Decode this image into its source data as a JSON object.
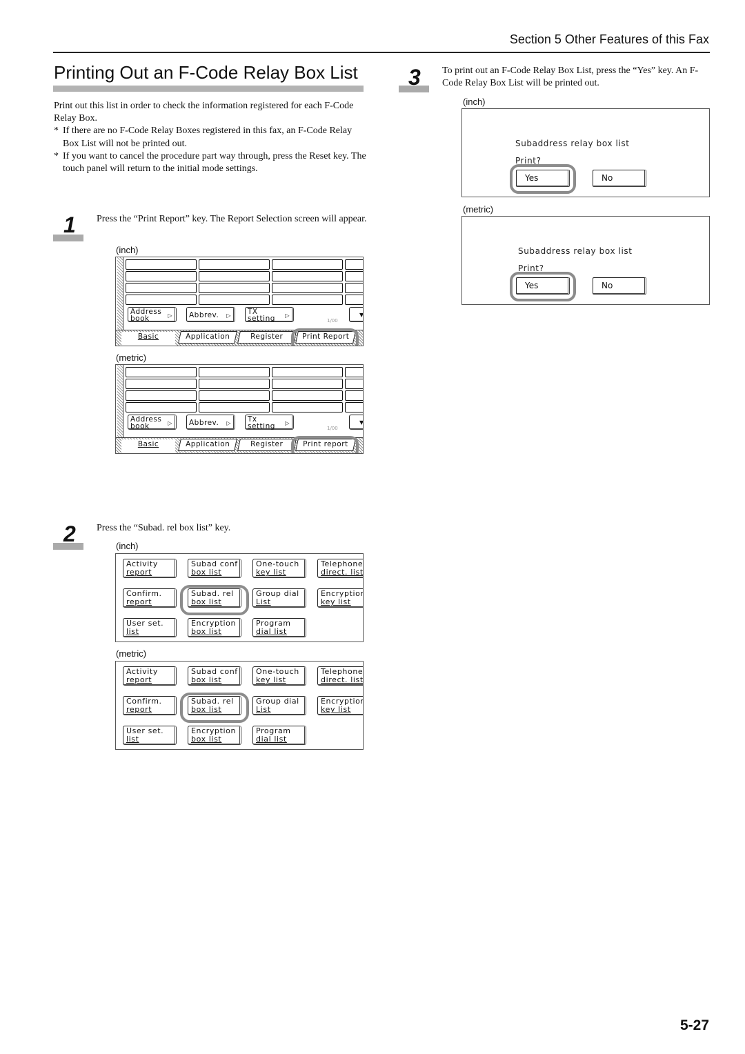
{
  "header": {
    "section": "Section 5  Other Features of this Fax"
  },
  "title": "Printing Out an F-Code Relay Box List",
  "intro": {
    "paragraph": "Print out this list in order to check the information registered for each F-Code Relay Box.",
    "notes": [
      "If there are no F-Code Relay Boxes registered in this fax, an F-Code Relay Box List will not be printed out.",
      "If you want to cancel the procedure part way through, press the Reset key. The touch panel will return to the initial mode settings."
    ],
    "bullet_marker": "*"
  },
  "steps": [
    {
      "number": "1",
      "text": "Press the “Print Report” key. The Report Selection screen will appear.",
      "screens": [
        {
          "caption": "(inch)",
          "keys": [
            {
              "line1": "Address",
              "line2": "book",
              "arrow": "▷"
            },
            {
              "line1": "Abbrev.",
              "line2": "",
              "arrow": "▷"
            },
            {
              "line1": "TX",
              "line2": "setting",
              "arrow": "▷"
            }
          ],
          "page_indicator": "1/00",
          "scroll_arrow": "▼",
          "tabs": [
            "Basic",
            "Application",
            "Register",
            "Print Report"
          ],
          "active_tab": "Basic",
          "highlighted": "Print Report"
        },
        {
          "caption": "(metric)",
          "keys": [
            {
              "line1": "Address",
              "line2": "book",
              "arrow": "▷"
            },
            {
              "line1": "Abbrev.",
              "line2": "",
              "arrow": "▷"
            },
            {
              "line1": "Tx",
              "line2": "setting",
              "arrow": "▷"
            }
          ],
          "page_indicator": "1/00",
          "scroll_arrow": "▼",
          "tabs": [
            "Basic",
            "Application",
            "Register",
            "Print report"
          ],
          "active_tab": "Basic",
          "highlighted": "Print report"
        }
      ]
    },
    {
      "number": "2",
      "text": "Press the “Subad. rel box list” key.",
      "screens": [
        {
          "caption": "(inch)",
          "keys": [
            [
              "Activity",
              "report"
            ],
            [
              "Subad conf",
              "box list"
            ],
            [
              "One-touch",
              "key list"
            ],
            [
              "Telephone",
              "direct. list"
            ],
            [
              "Confirm.",
              "report"
            ],
            [
              "Subad. rel",
              "box list"
            ],
            [
              "Group dial",
              "List"
            ],
            [
              "Encryption",
              "key list"
            ],
            [
              "User set.",
              "list"
            ],
            [
              "Encryption",
              "box list"
            ],
            [
              "Program",
              "dial list"
            ]
          ],
          "highlighted": "Subad. rel box list"
        },
        {
          "caption": "(metric)",
          "keys": [
            [
              "Activity",
              "report"
            ],
            [
              "Subad conf",
              "box list"
            ],
            [
              "One-touch",
              "key list"
            ],
            [
              "Telephone",
              "direct. list"
            ],
            [
              "Confirm.",
              "report"
            ],
            [
              "Subad. rel",
              "box list"
            ],
            [
              "Group dial",
              "List"
            ],
            [
              "Encryption",
              "key list"
            ],
            [
              "User set.",
              "list"
            ],
            [
              "Encryption",
              "box list"
            ],
            [
              "Program",
              "dial list"
            ]
          ],
          "highlighted": "Subad. rel box list"
        }
      ]
    },
    {
      "number": "3",
      "text": "To print out an F-Code Relay Box List, press the “Yes” key. An F-Code Relay Box List will be printed out.",
      "screens": [
        {
          "caption": "(inch)",
          "message": "Subaddress relay box list",
          "prompt": "Print?",
          "yes": "Yes",
          "no": "No",
          "highlighted": "Yes"
        },
        {
          "caption": "(metric)",
          "message": "Subaddress relay box list",
          "prompt": "Print?",
          "yes": "Yes",
          "no": "No",
          "highlighted": "Yes"
        }
      ]
    }
  ],
  "page_number": "5-27"
}
